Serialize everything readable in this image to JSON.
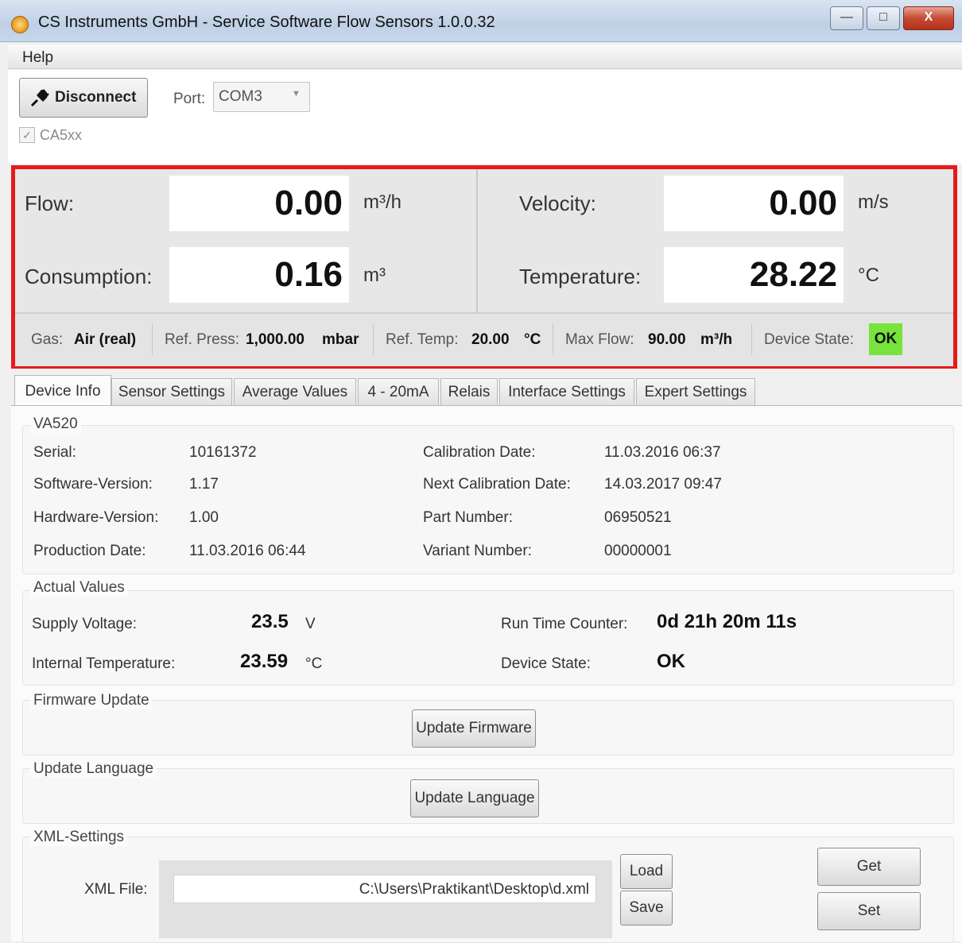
{
  "window": {
    "title": "CS Instruments GmbH - Service Software Flow Sensors  1.0.0.32",
    "controls": {
      "minimize": "—",
      "maximize": "□",
      "close": "X"
    }
  },
  "menu": {
    "help": "Help"
  },
  "connection": {
    "disconnect_label": "Disconnect",
    "port_label": "Port:",
    "port_value": "COM3",
    "ca5xx_label": "CA5xx",
    "ca5xx_checked": true
  },
  "readings": {
    "flow": {
      "label": "Flow:",
      "value": "0.00",
      "unit": "m³/h"
    },
    "consumption": {
      "label": "Consumption:",
      "value": "0.16",
      "unit": "m³"
    },
    "velocity": {
      "label": "Velocity:",
      "value": "0.00",
      "unit": "m/s"
    },
    "temperature": {
      "label": "Temperature:",
      "value": "28.22",
      "unit": "°C"
    }
  },
  "status": {
    "gas_label": "Gas:",
    "gas_value": "Air (real)",
    "ref_press_label": "Ref. Press:",
    "ref_press_value": "1,000.00",
    "ref_press_unit": "mbar",
    "ref_temp_label": "Ref. Temp:",
    "ref_temp_value": "20.00",
    "ref_temp_unit": "°C",
    "max_flow_label": "Max Flow:",
    "max_flow_value": "90.00",
    "max_flow_unit": "m³/h",
    "device_state_label": "Device State:",
    "device_state_value": "OK",
    "ok_color": "#77e33d"
  },
  "tabs": [
    "Device Info",
    "Sensor Settings",
    "Average Values",
    "4 - 20mA",
    "Relais",
    "Interface Settings",
    "Expert Settings"
  ],
  "device_info": {
    "group_title": "VA520",
    "serial_label": "Serial:",
    "serial_value": "10161372",
    "software_label": "Software-Version:",
    "software_value": "1.17",
    "hardware_label": "Hardware-Version:",
    "hardware_value": "1.00",
    "production_label": "Production Date:",
    "production_value": "11.03.2016 06:44",
    "calibration_label": "Calibration Date:",
    "calibration_value": "11.03.2016 06:37",
    "next_calibration_label": "Next Calibration Date:",
    "next_calibration_value": "14.03.2017 09:47",
    "part_label": "Part Number:",
    "part_value": "06950521",
    "variant_label": "Variant Number:",
    "variant_value": "00000001"
  },
  "actual_values": {
    "group_title": "Actual Values",
    "supply_label": "Supply Voltage:",
    "supply_value": "23.5",
    "supply_unit": "V",
    "internal_temp_label": "Internal Temperature:",
    "internal_temp_value": "23.59",
    "internal_temp_unit": "°C",
    "runtime_label": "Run Time Counter:",
    "runtime_value": "0d 21h 20m 11s",
    "device_state_label": "Device State:",
    "device_state_value": "OK"
  },
  "firmware": {
    "group_title": "Firmware Update",
    "button": "Update Firmware"
  },
  "language": {
    "group_title": "Update Language",
    "button": "Update Language"
  },
  "xml": {
    "group_title": "XML-Settings",
    "file_label": "XML File:",
    "file_path": "C:\\Users\\Praktikant\\Desktop\\d.xml",
    "load": "Load",
    "save": "Save",
    "get": "Get",
    "set": "Set"
  }
}
